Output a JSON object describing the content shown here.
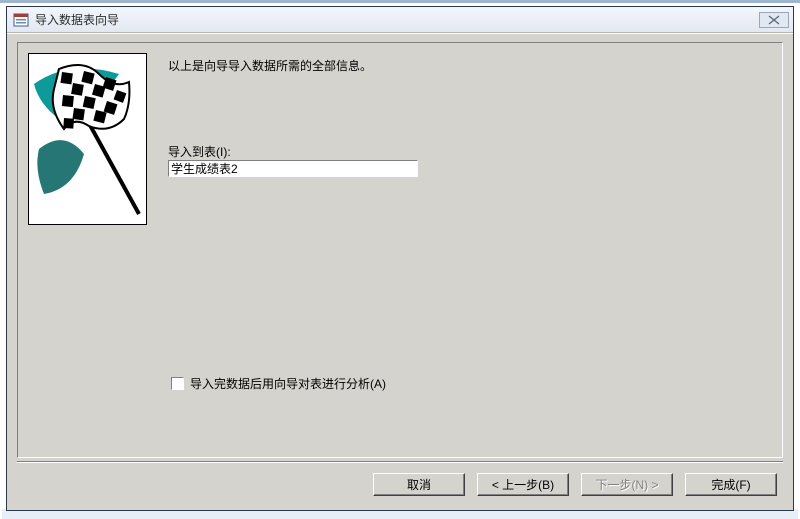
{
  "titlebar": {
    "title": "导入数据表向导"
  },
  "content": {
    "info": "以上是向导导入数据所需的全部信息。",
    "importToLabel": "导入到表(I):",
    "tableName": "学生成绩表2",
    "analyzeCheckbox": "导入完数据后用向导对表进行分析(A)"
  },
  "buttons": {
    "cancel": "取消",
    "back": "< 上一步(B)",
    "next": "下一步(N) >",
    "finish": "完成(F)"
  }
}
